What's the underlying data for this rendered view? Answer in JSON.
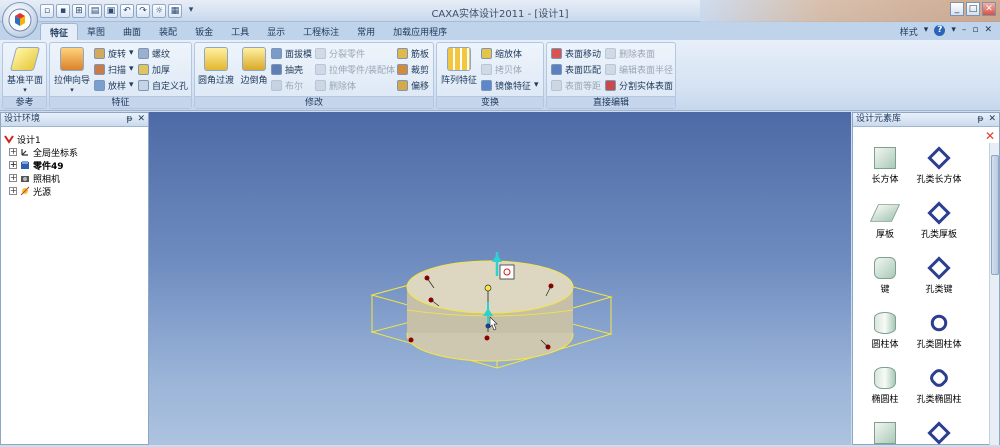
{
  "window": {
    "title": "CAXA实体设计2011 - [设计1]",
    "controls": [
      "_",
      "□",
      "✕"
    ]
  },
  "tabs": [
    "特征",
    "草图",
    "曲面",
    "装配",
    "钣金",
    "工具",
    "显示",
    "工程标注",
    "常用",
    "加载应用程序"
  ],
  "tab_right": {
    "style_label": "样式",
    "help": "?"
  },
  "ribbon": {
    "groups": [
      {
        "label": "参考",
        "big": [
          "基准平面"
        ]
      },
      {
        "label": "特征",
        "big": [
          "拉伸向导"
        ],
        "small": [
          "旋转",
          "扫描",
          "放样",
          "螺纹",
          "加厚",
          "自定义孔"
        ]
      },
      {
        "label": "修改",
        "big": [
          "圆角过渡",
          "边倒角"
        ],
        "small": [
          "面拔模",
          "抽壳",
          "布尔",
          "分裂零件",
          "拉伸零件/装配体",
          "删除体",
          "筋板",
          "裁剪",
          "偏移"
        ]
      },
      {
        "label": "变换",
        "big": [
          "阵列特征"
        ],
        "small": [
          "缩放体",
          "拷贝体",
          "镜像特征"
        ]
      },
      {
        "label": "直接编辑",
        "small": [
          "表面移动",
          "表面匹配",
          "表面等距",
          "删除表面",
          "编辑表面半径",
          "分割实体表面"
        ]
      }
    ]
  },
  "left_panel": {
    "title": "设计环境",
    "tree": [
      {
        "label": "设计1"
      },
      {
        "label": "全局坐标系"
      },
      {
        "label": "零件49"
      },
      {
        "label": "照相机"
      },
      {
        "label": "光源"
      }
    ]
  },
  "right_panel": {
    "title": "设计元素库",
    "items": [
      "长方体",
      "孔类长方体",
      "厚板",
      "孔类厚板",
      "键",
      "孔类键",
      "圆柱体",
      "孔类圆柱体",
      "椭圆柱",
      "孔类椭圆柱"
    ]
  },
  "colors": {
    "viewport_top": "#4e6aa6",
    "viewport_bottom": "#adc3df",
    "bounding_box": "#f5e642",
    "part_fill": "#d9d3bf",
    "handle_point": "#8b0000",
    "axis_cyan": "#2fd0d0",
    "close_red": "#e23b2e"
  }
}
